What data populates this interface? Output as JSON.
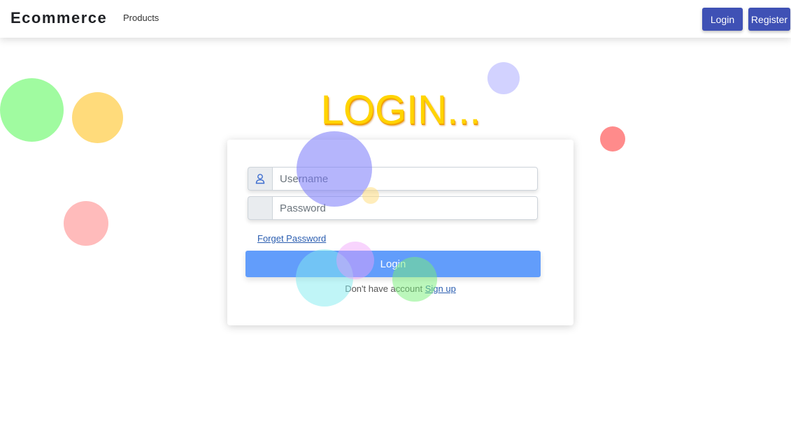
{
  "navbar": {
    "brand": "Ecommerce",
    "links": {
      "products": "Products"
    },
    "login_label": "Login",
    "register_label": "Register",
    "button_color": "#3f51b5"
  },
  "hero": {
    "title": "LOGIN..."
  },
  "form": {
    "username_placeholder": "Username",
    "password_placeholder": "Password",
    "username_icon": "user-icon",
    "forgot_label": "Forget Password",
    "submit_label": "Login",
    "signup_prompt": "Don't have account",
    "signup_link": "Sign up"
  },
  "colors": {
    "title": "#ffd400",
    "submit": "#468cfa",
    "link": "#2a5db0"
  }
}
